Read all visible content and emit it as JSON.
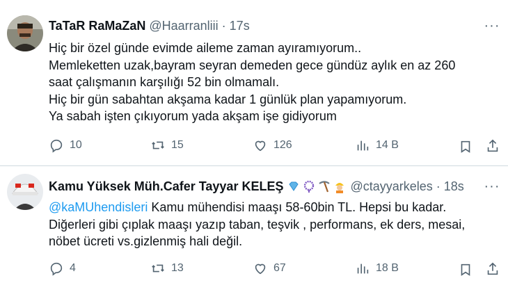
{
  "tweets": [
    {
      "author": {
        "name": "TaTaR RaMaZaN",
        "handle": "@Haarranliii",
        "time": "17s"
      },
      "lines": [
        "Hiç bir özel günde evimde aileme zaman ayıramıyorum..",
        "Memleketten uzak,bayram seyran demeden gece gündüz aylık en az 260",
        "saat çalışmanın karşılığı 52 bin olmamalı.",
        "Hiç bir gün sabahtan akşama kadar 1 günlük plan yapamıyorum.",
        "Ya sabah işten çıkıyorum yada akşam işe gidiyorum"
      ],
      "stats": {
        "replies": "10",
        "retweets": "15",
        "likes": "126",
        "views": "14 B"
      }
    },
    {
      "author": {
        "name": "Kamu Yüksek Müh.Cafer Tayyar KELEŞ",
        "handle": "@ctayyarkeles",
        "time": "18s"
      },
      "mention": "@kaMUhendisleri",
      "lines": [
        " Kamu mühendisi maaşı 58-60bin TL. Hepsi bu kadar.",
        "Diğerleri gibi çıplak maaşı yazıp taban, teşvik , performans, ek ders, mesai,",
        "nöbet ücreti vs.gizlenmiş hali değil."
      ],
      "stats": {
        "replies": "4",
        "retweets": "13",
        "likes": "67",
        "views": "18 B"
      }
    }
  ],
  "ui": {
    "separator": "·",
    "more": "···"
  },
  "colors": {
    "text": "#0f1419",
    "muted": "#536471",
    "link": "#1d9bf0",
    "divider": "#cfd9de"
  }
}
